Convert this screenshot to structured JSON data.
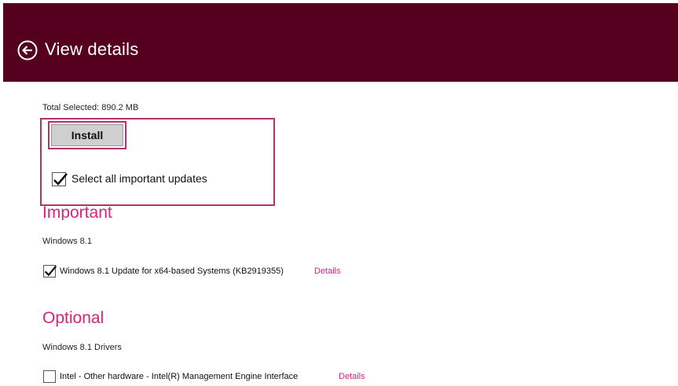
{
  "header": {
    "title": "View details",
    "back_icon": "circle-arrow-left-icon",
    "background_color": "#55001f"
  },
  "summary": {
    "total_selected": "Total Selected: 890.2 MB"
  },
  "actions": {
    "install_label": "Install",
    "select_all_label": "Select all important updates",
    "select_all_checked": true,
    "highlight_color": "#b5326a"
  },
  "sections": {
    "important": {
      "heading": "Important",
      "group": "Windows 8.1",
      "item": {
        "label": "Windows 8.1 Update for x64-based Systems (KB2919355)",
        "checked": true,
        "details_label": "Details"
      }
    },
    "optional": {
      "heading": "Optional",
      "group": "Windows 8.1 Drivers",
      "item": {
        "label": "Intel - Other hardware - Intel(R) Management Engine Interface",
        "checked": false,
        "details_label": "Details"
      }
    },
    "accent_color": "#d6247e"
  }
}
